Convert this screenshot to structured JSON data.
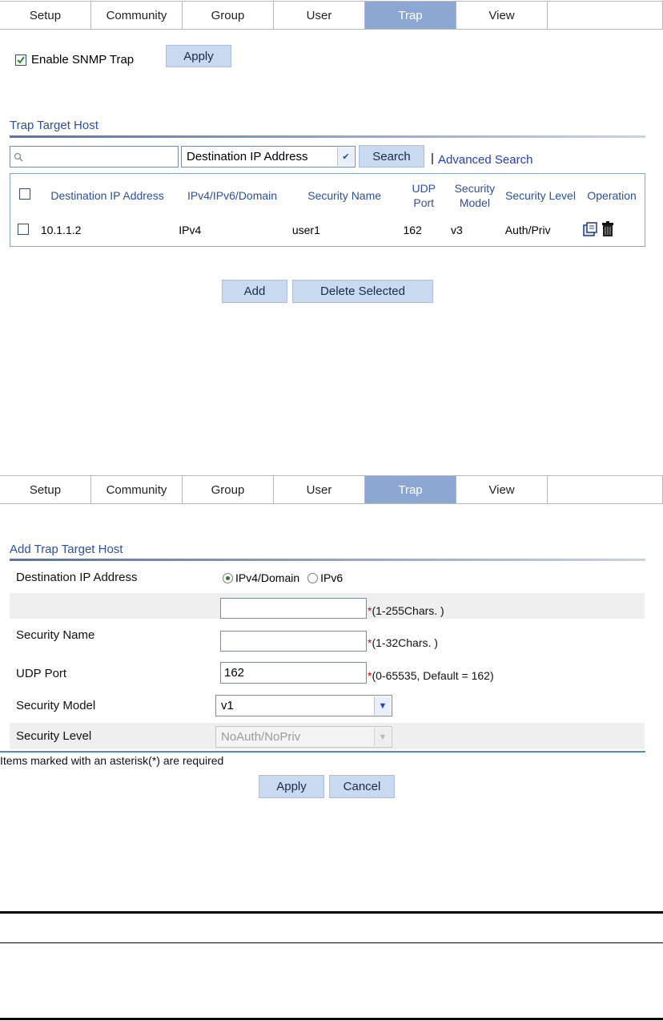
{
  "tabs_top": [
    "Setup",
    "Community",
    "Group",
    "User",
    "Trap",
    "View"
  ],
  "tabs_bottom": [
    "Setup",
    "Community",
    "Group",
    "User",
    "Trap",
    "View"
  ],
  "active_tab": "Trap",
  "trap_page": {
    "enable_label": "Enable SNMP Trap",
    "enable_checked": true,
    "apply_label": "Apply",
    "section_title": "Trap Target Host",
    "search_value": "",
    "search_field_selected": "Destination IP Address",
    "search_button": "Search",
    "advanced_search": "Advanced Search",
    "columns": [
      "Destination IP Address",
      "IPv4/IPv6/Domain",
      "Security Name",
      "UDP Port",
      "Security Model",
      "Security Level",
      "Operation"
    ],
    "rows": [
      {
        "dest": "10.1.1.2",
        "type": "IPv4",
        "name": "user1",
        "port": "162",
        "model": "v3",
        "level": "Auth/Priv"
      }
    ],
    "add_button": "Add",
    "delete_button": "Delete Selected"
  },
  "add_page": {
    "section_title": "Add Trap Target Host",
    "dest_label": "Destination IP Address",
    "radio_ipv4": "IPv4/Domain",
    "radio_ipv6": "IPv6",
    "radio_selected": "IPv4/Domain",
    "dest_value": "",
    "dest_hint": "(1-255Chars. )",
    "name_label": "Security Name",
    "name_value": "",
    "name_hint": "(1-32Chars. )",
    "port_label": "UDP Port",
    "port_value": "162",
    "port_hint": "(0-65535, Default = 162)",
    "model_label": "Security Model",
    "model_value": "v1",
    "level_label": "Security Level",
    "level_value": "NoAuth/NoPriv",
    "required_note": "Items marked with an asterisk(*) are required",
    "star": "*",
    "apply_button": "Apply",
    "cancel_button": "Cancel"
  },
  "colors": {
    "accent": "#8da7d3",
    "link": "#1f3fbf",
    "button": "#c9d9ef",
    "title": "#2c4f9e"
  }
}
